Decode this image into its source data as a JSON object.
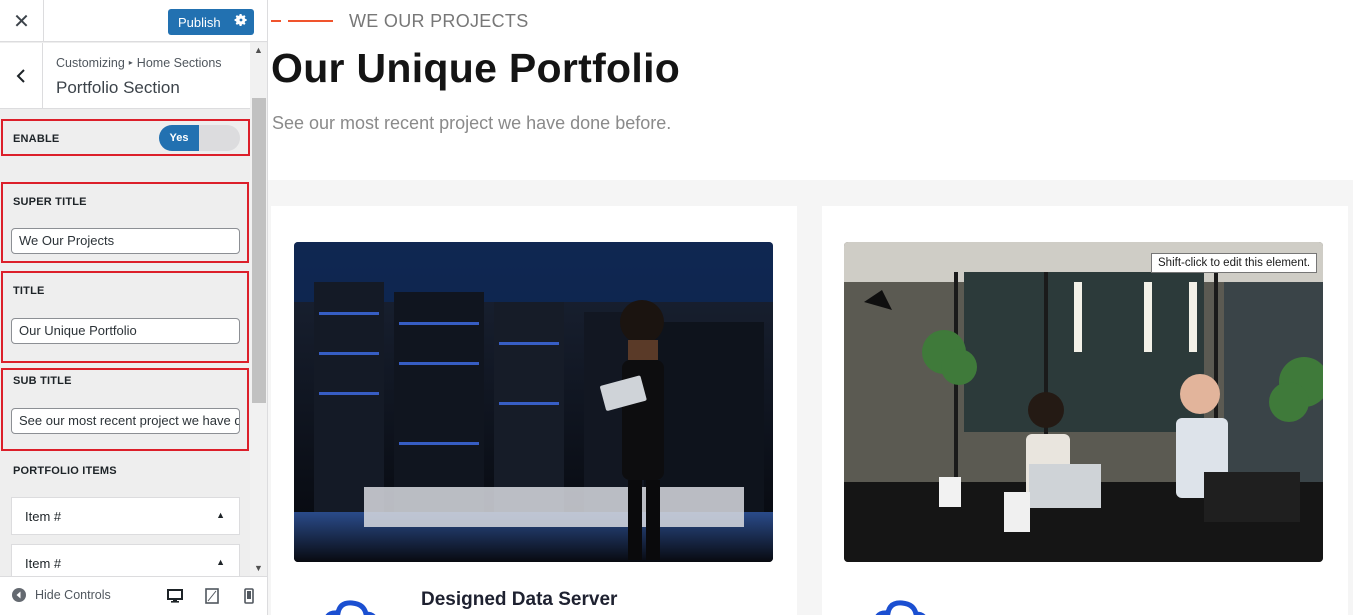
{
  "topbar": {
    "close_icon": "close-icon",
    "publish_label": "Publish",
    "settings_icon": "gear-icon"
  },
  "section_header": {
    "breadcrumb_root": "Customizing",
    "breadcrumb_parent": "Home Sections",
    "title": "Portfolio Section"
  },
  "controls": {
    "enable": {
      "label": "ENABLE",
      "toggle_on_label": "Yes",
      "value": true
    },
    "super_title": {
      "label": "SUPER TITLE",
      "value": "We Our Projects"
    },
    "title": {
      "label": "TITLE",
      "value": "Our Unique Portfolio"
    },
    "sub_title": {
      "label": "SUB TITLE",
      "value": "See our most recent project we have done before."
    },
    "portfolio_items": {
      "label": "PORTFOLIO ITEMS",
      "items": [
        {
          "label": "Item #"
        },
        {
          "label": "Item #"
        }
      ]
    }
  },
  "footer": {
    "hide_controls_label": "Hide Controls",
    "devices": [
      "desktop",
      "tablet",
      "mobile"
    ]
  },
  "preview": {
    "super_title": "WE OUR PROJECTS",
    "title": "Our Unique Portfolio",
    "subtitle": "See our most recent project we have done before.",
    "cards": [
      {
        "title": "Designed Data Server",
        "icon": "cloud-icon"
      },
      {
        "title": "",
        "icon": "cloud-icon"
      }
    ],
    "tooltip": "Shift-click to edit this element."
  },
  "colors": {
    "accent": "#2271b1",
    "highlight_border": "#dc1f2a",
    "brand_dash": "#f0542d",
    "icon_blue": "#1b4fd1"
  }
}
